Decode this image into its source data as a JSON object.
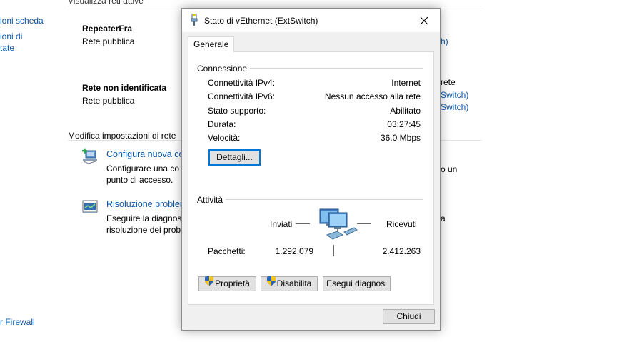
{
  "background": {
    "left_items": {
      "cambia_scheda": "ioni scheda",
      "opzioni_line1": "ioni di",
      "opzioni_line2": "tate",
      "firewall": "r Firewall"
    },
    "active_networks_heading": "Visualizza reti attive",
    "networks": [
      {
        "name": "RepeaterFra",
        "type": "Rete pubblica"
      },
      {
        "name": "Rete non identificata",
        "type": "Rete pubblica"
      }
    ],
    "right_fragments": {
      "link1": "h)",
      "rete": "rete",
      "switch1": "Switch)",
      "switch2": "Switch)",
      "un": "o un",
      "a": "a"
    },
    "modify_heading": "Modifica impostazioni di rete",
    "tasks": [
      {
        "link": "Configura nuova co",
        "desc1": "Configurare una co",
        "desc2": "punto di accesso."
      },
      {
        "link": "Risoluzione problem",
        "desc1": "Eseguire la diagnosi",
        "desc2": "risoluzione dei probl"
      }
    ]
  },
  "dialog": {
    "title": "Stato di vEthernet (ExtSwitch)",
    "tab": "Generale",
    "connection": {
      "heading": "Connessione",
      "rows": [
        {
          "label": "Connettività IPv4:",
          "value": "Internet"
        },
        {
          "label": "Connettività IPv6:",
          "value": "Nessun accesso alla rete"
        },
        {
          "label": "Stato supporto:",
          "value": "Abilitato"
        },
        {
          "label": "Durata:",
          "value": "03:27:45"
        },
        {
          "label": "Velocità:",
          "value": "36.0 Mbps"
        }
      ],
      "details_button": "Dettagli..."
    },
    "activity": {
      "heading": "Attività",
      "sent_label": "Inviati",
      "received_label": "Ricevuti",
      "packets_label": "Pacchetti:",
      "packets_sent": "1.292.079",
      "packets_received": "2.412.263"
    },
    "buttons": {
      "properties": "Proprietà",
      "disable": "Disabilita",
      "diagnose": "Esegui diagnosi",
      "close": "Chiudi"
    }
  },
  "colors": {
    "link": "#0b57a8",
    "focus": "#0078d7",
    "button_face": "#e1e1e1",
    "dialog_bg": "#f0f0f0"
  }
}
